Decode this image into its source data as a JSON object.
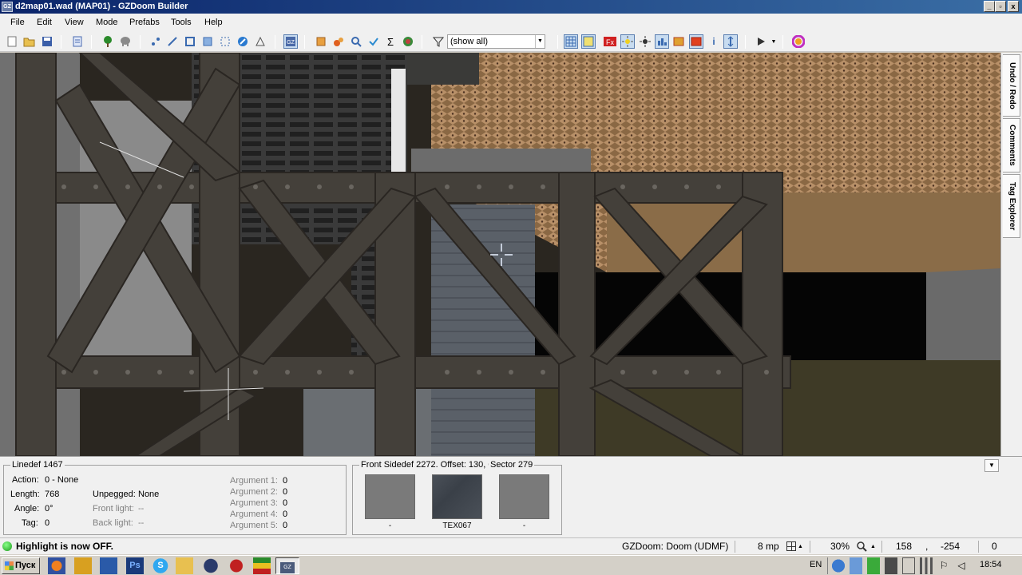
{
  "window": {
    "title": "d2map01.wad (MAP01) - GZDoom Builder",
    "app_icon_text": "GZ",
    "minimize": "_",
    "maximize": "▫",
    "close": "x"
  },
  "menu": [
    "File",
    "Edit",
    "View",
    "Mode",
    "Prefabs",
    "Tools",
    "Help"
  ],
  "toolbar": {
    "filter_value": "(show all)"
  },
  "side_tabs": [
    "Undo / Redo",
    "Comments",
    "Tag Explorer"
  ],
  "linedef_panel": {
    "title": "Linedef 1467",
    "action_label": "Action:",
    "action_value": "0 - None",
    "length_label": "Length:",
    "length_value": "768",
    "angle_label": "Angle:",
    "angle_value": "0°",
    "tag_label": "Tag:",
    "tag_value": "0",
    "unpegged_label": "Unpegged:",
    "unpegged_value": "None",
    "frontlight_label": "Front light:",
    "frontlight_value": "--",
    "backlight_label": "Back light:",
    "backlight_value": "--",
    "arguments": [
      {
        "label": "Argument 1:",
        "value": "0"
      },
      {
        "label": "Argument 2:",
        "value": "0"
      },
      {
        "label": "Argument 3:",
        "value": "0"
      },
      {
        "label": "Argument 4:",
        "value": "0"
      },
      {
        "label": "Argument 5:",
        "value": "0"
      }
    ]
  },
  "sidedef_panel": {
    "title": "Front Sidedef 2272. Offset: 130, 0",
    "sector_title": "Sector 279",
    "textures": [
      {
        "name": "-"
      },
      {
        "name": "TEX067"
      },
      {
        "name": "-"
      }
    ]
  },
  "statusbar": {
    "message": "Highlight is now OFF.",
    "engine": "GZDoom: Doom (UDMF)",
    "grid": "8 mp",
    "zoom": "30%",
    "coord_x": "158",
    "coord_sep": ",",
    "coord_y": "-254",
    "count": "0"
  },
  "taskbar": {
    "start_label": "Пуск",
    "lang": "EN",
    "time": "18:54"
  }
}
